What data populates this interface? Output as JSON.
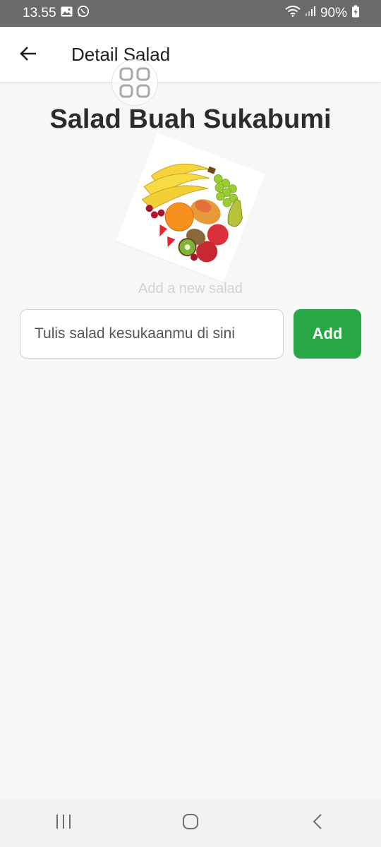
{
  "status_bar": {
    "time": "13.55",
    "battery": "90%",
    "icons": [
      "gallery-icon",
      "whatsapp-icon",
      "wifi-icon",
      "signal-icon",
      "battery-charging-icon"
    ]
  },
  "app_bar": {
    "title": "Detail Salad",
    "back_icon": "arrow-left-icon",
    "overlay_icon": "grid-apps-icon"
  },
  "main": {
    "title": "Salad Buah Sukabumi",
    "image_alt": "fruit-salad-image",
    "subtitle": "Add a new salad",
    "input": {
      "value": "",
      "placeholder": "Tulis salad kesukaanmu di sini"
    },
    "add_button_label": "Add"
  },
  "nav_bar": {
    "icons": [
      "recent-apps-icon",
      "home-icon",
      "back-icon"
    ]
  },
  "colors": {
    "status_bar": "#6b6b6b",
    "accent": "#28a745",
    "background": "#f6f7f9"
  }
}
